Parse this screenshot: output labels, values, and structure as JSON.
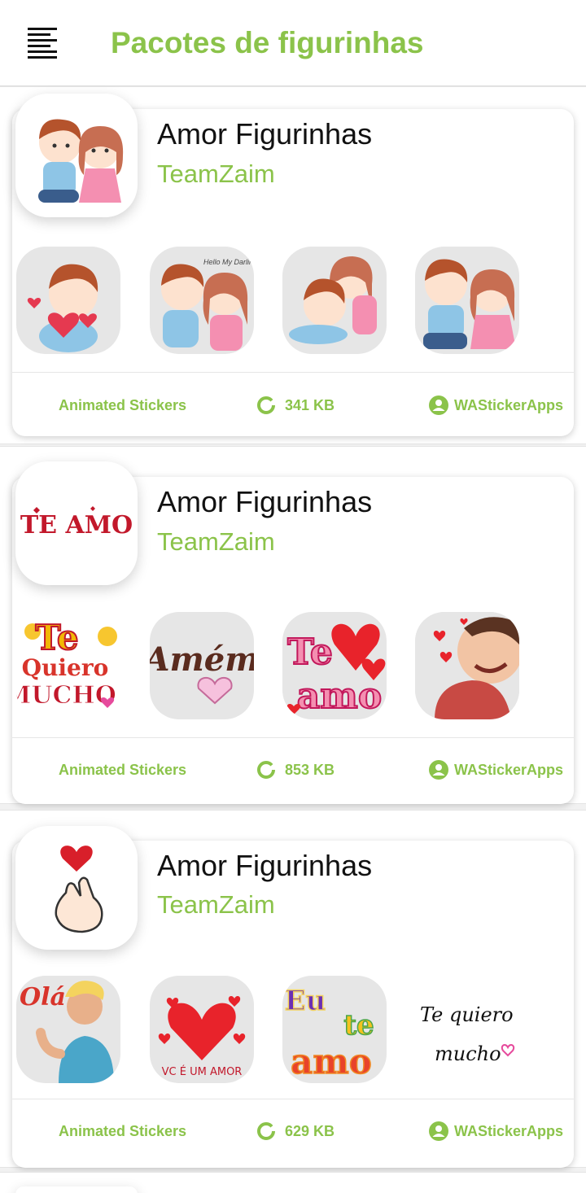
{
  "header": {
    "title": "Pacotes de figurinhas",
    "menu_icon": "menu-icon"
  },
  "colors": {
    "accent": "#8bc34a",
    "text": "#111111"
  },
  "packs": [
    {
      "name": "Amor Figurinhas",
      "author": "TeamZaim",
      "type": "Animated Stickers",
      "size": "341 KB",
      "publisher": "WAStickerApps"
    },
    {
      "name": "Amor Figurinhas",
      "author": "TeamZaim",
      "type": "Animated Stickers",
      "size": "853 KB",
      "publisher": "WAStickerApps",
      "tray_text": "TE AMO",
      "sticker_texts": [
        "Te",
        "Quiero",
        "MUCHO",
        "Amém",
        "Te",
        "amo"
      ]
    },
    {
      "name": "Amor Figurinhas",
      "author": "TeamZaim",
      "type": "Animated Stickers",
      "size": "629 KB",
      "publisher": "WAStickerApps",
      "sticker_texts": [
        "Olá",
        "VC É UM AMOR",
        "Eu",
        "te",
        "amo",
        "Te quiero",
        "mucho"
      ]
    }
  ]
}
